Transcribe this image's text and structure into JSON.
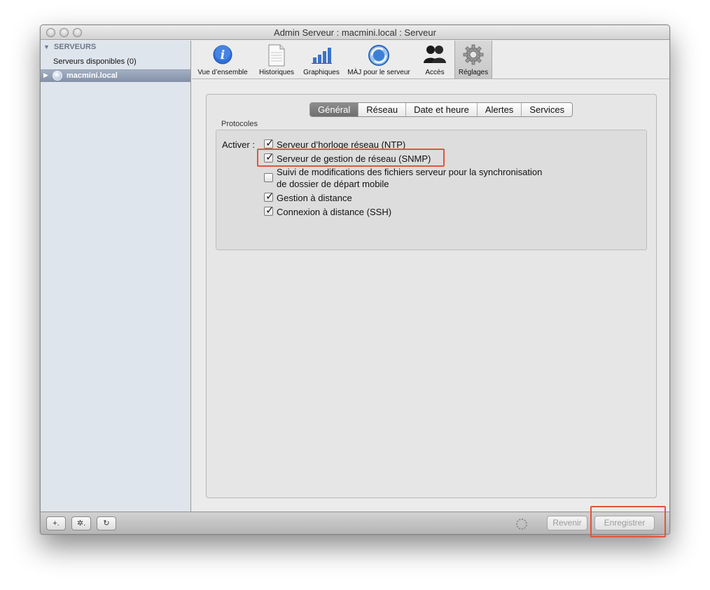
{
  "window": {
    "title": "Admin Serveur : macmini.local : Serveur"
  },
  "sidebar": {
    "header": "SERVEURS",
    "available": "Serveurs disponibles (0)",
    "selected_server": "macmini.local"
  },
  "toolbar": {
    "items": [
      {
        "label": "Vue d’ensemble",
        "icon": "info-icon"
      },
      {
        "label": "Historiques",
        "icon": "document-icon"
      },
      {
        "label": "Graphiques",
        "icon": "bar-chart-icon"
      },
      {
        "label": "MÀJ pour le serveur",
        "icon": "software-update-icon"
      },
      {
        "label": "Accès",
        "icon": "users-icon"
      },
      {
        "label": "Réglages",
        "icon": "gear-icon",
        "active": true
      }
    ]
  },
  "tabs": [
    {
      "label": "Général",
      "selected": true
    },
    {
      "label": "Réseau"
    },
    {
      "label": "Date et heure"
    },
    {
      "label": "Alertes"
    },
    {
      "label": "Services"
    }
  ],
  "protocols": {
    "group_label": "Protocoles",
    "activer_label": "Activer :",
    "options": [
      {
        "label": "Serveur d’horloge réseau (NTP)",
        "checked": true
      },
      {
        "label": "Serveur de gestion de réseau (SNMP)",
        "checked": true
      },
      {
        "label_line1": "Suivi de modifications des fichiers serveur pour la synchronisation",
        "label_line2": "de dossier de départ mobile",
        "checked": false
      },
      {
        "label": "Gestion à distance",
        "checked": true
      },
      {
        "label": "Connexion à distance (SSH)",
        "checked": true
      }
    ]
  },
  "bottom": {
    "add_label": "+.",
    "action_label": "✲.",
    "refresh_label": "↻",
    "revert_label": "Revenir",
    "save_label": "Enregistrer"
  },
  "colors": {
    "highlight": "#e5533c",
    "selection": "#8a97ae"
  }
}
